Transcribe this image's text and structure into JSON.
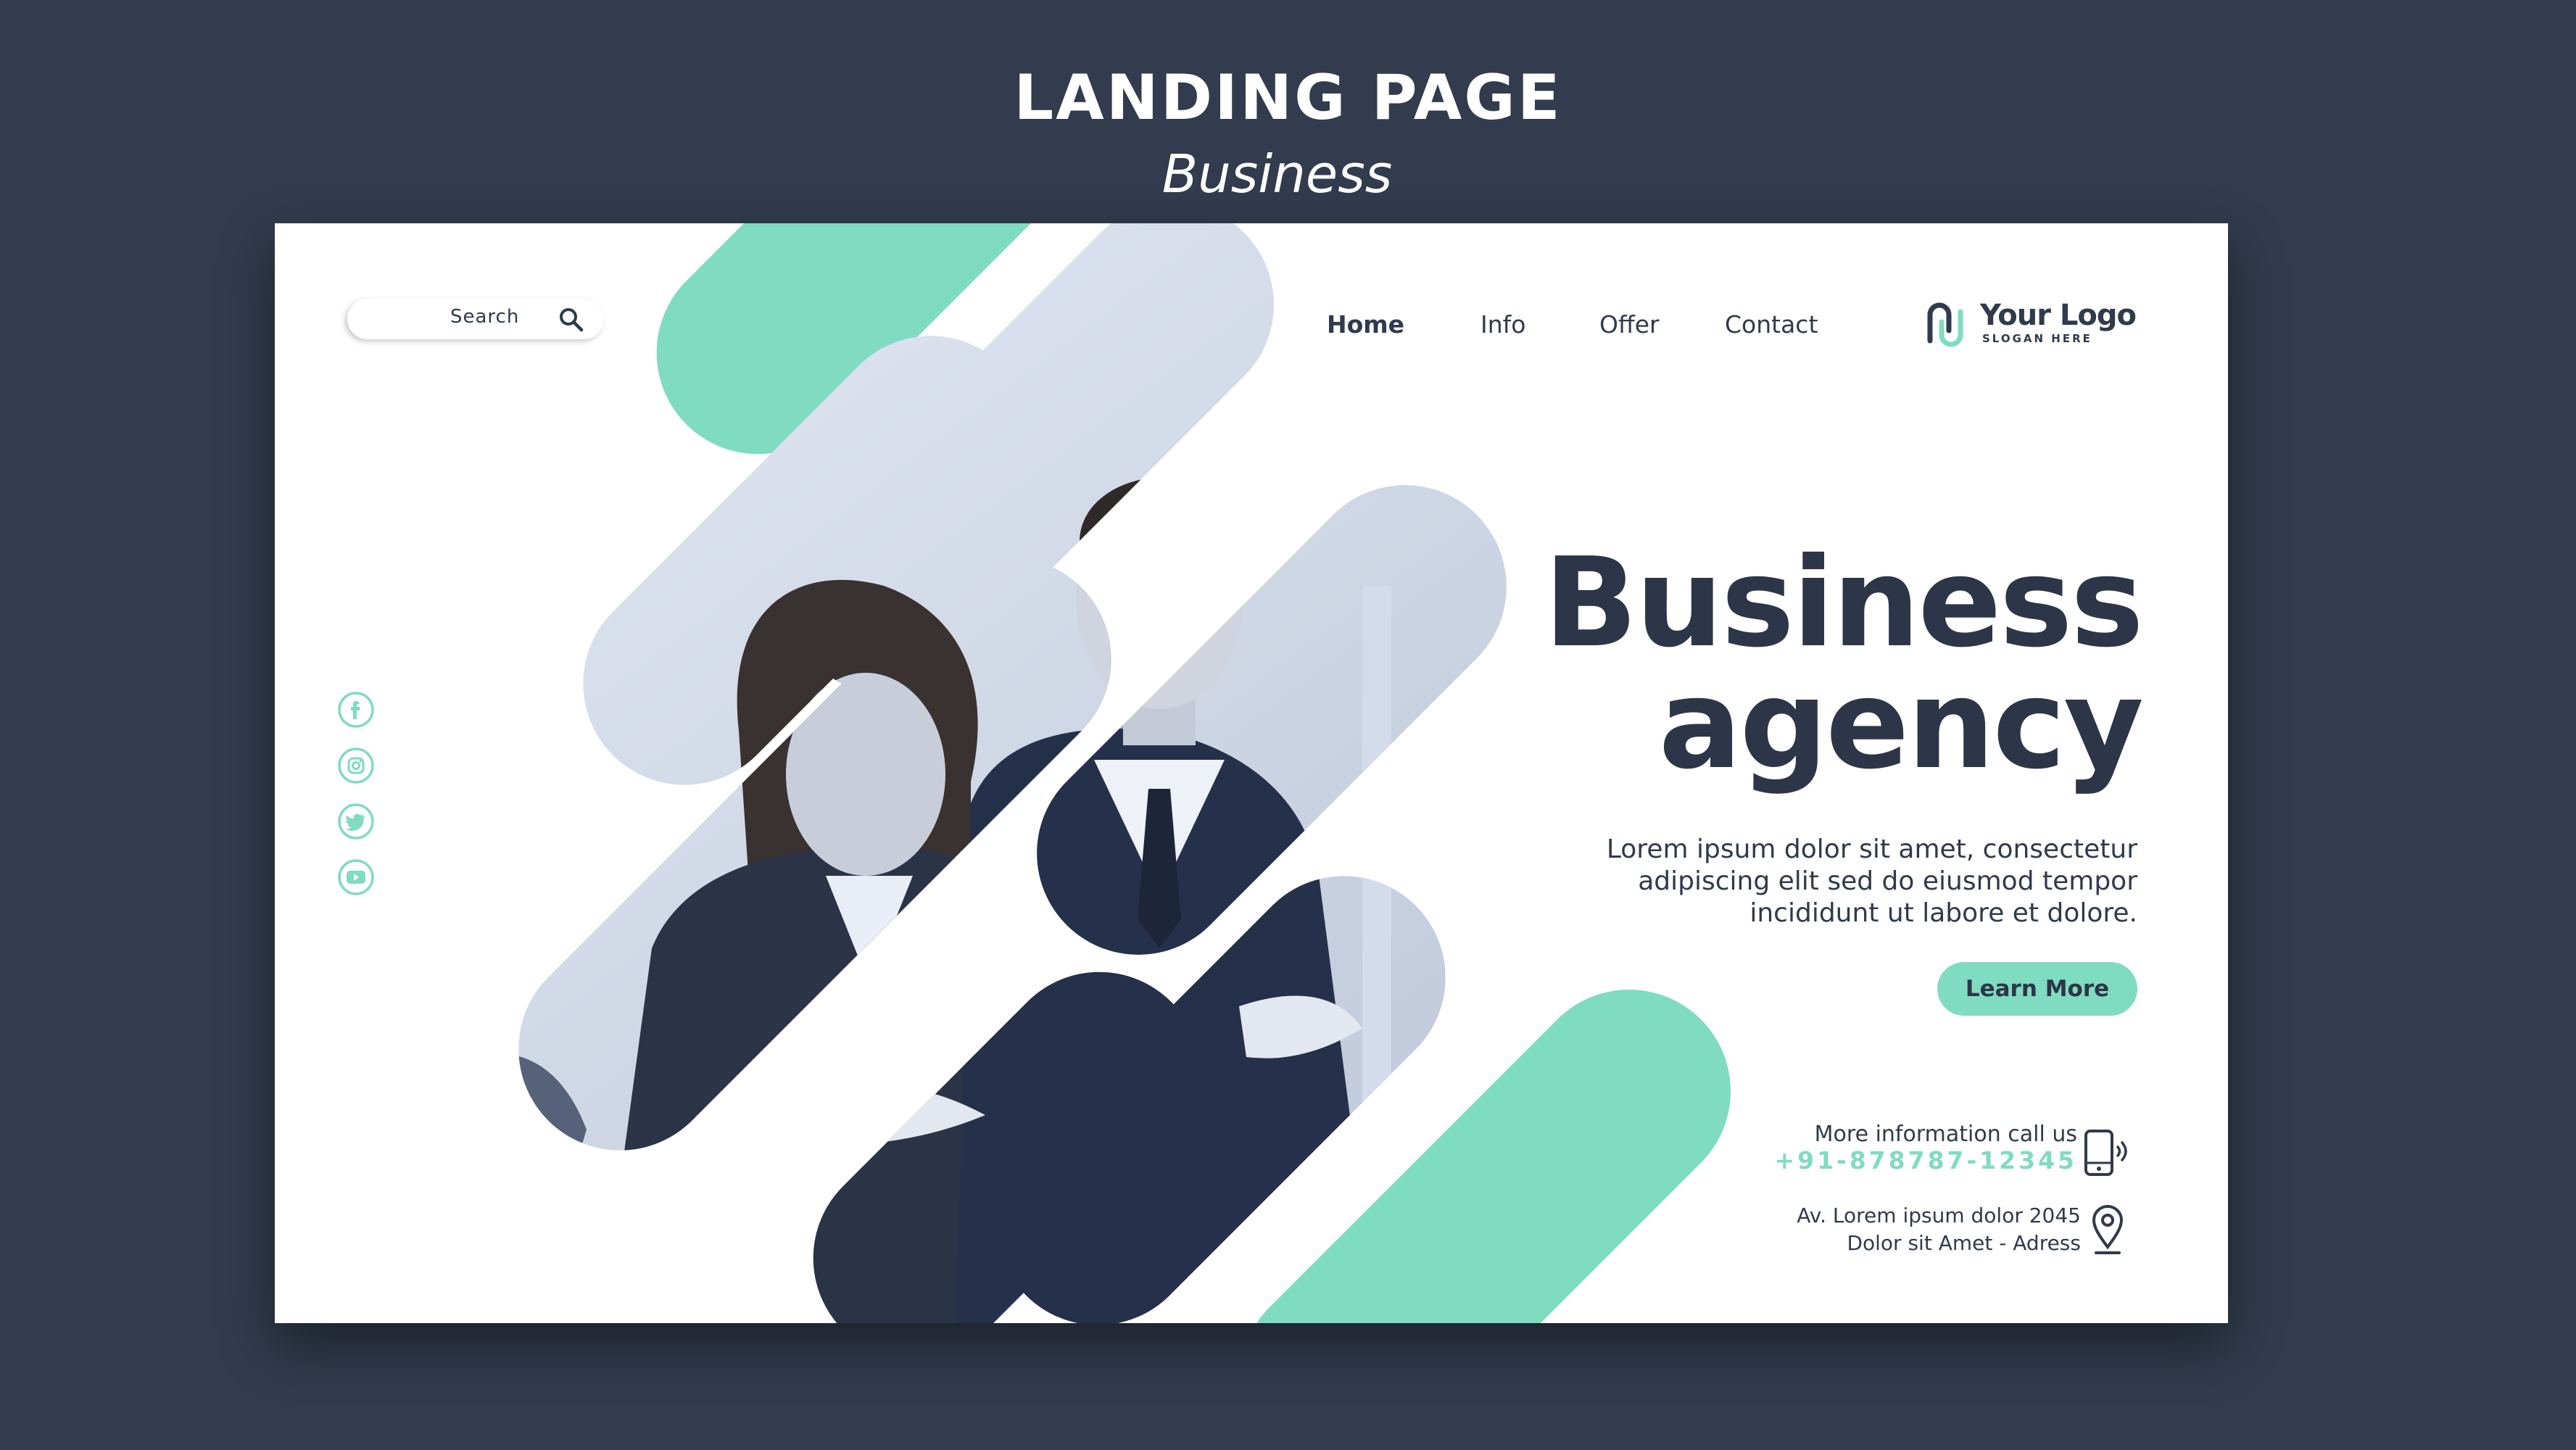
{
  "page_heading": {
    "title": "LANDING PAGE",
    "subtitle": "Business"
  },
  "search": {
    "label": "Search",
    "icon": "magnifier-icon"
  },
  "nav": {
    "items": [
      "Home",
      "Info",
      "Offer",
      "Contact"
    ],
    "active": "Home"
  },
  "logo": {
    "name": "Your Logo",
    "slogan": "SLOGAN HERE"
  },
  "social_icons": [
    "facebook-icon",
    "instagram-icon",
    "twitter-icon",
    "youtube-icon"
  ],
  "hero": {
    "title_line1": "Business",
    "title_line2": "agency",
    "body_line1": "Lorem ipsum dolor sit amet, consectetur",
    "body_line2": "adipiscing elit sed do eiusmod tempor",
    "body_line3": "incididunt ut labore et dolore.",
    "cta": "Learn More"
  },
  "contact": {
    "call_label": "More information call us",
    "phone": "+91-878787-12345",
    "address_line1": "Av. Lorem ipsum dolor 2045",
    "address_line2": "Dolor sit Amet - Adress"
  },
  "colors": {
    "background": "#323c4e",
    "accent": "#7fdcc0",
    "text_dark": "#2d3648",
    "card": "#ffffff"
  }
}
